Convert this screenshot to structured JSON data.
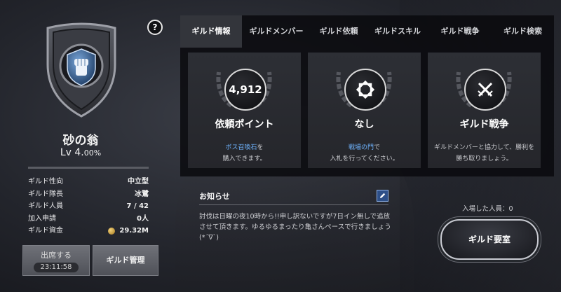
{
  "guild": {
    "name": "砂の翁",
    "level_label": "Lv 4.",
    "level_pct": "00%",
    "level_progress": 0.0
  },
  "help_icon_text": "?",
  "info": [
    {
      "label": "ギルド性向",
      "value": "中立型"
    },
    {
      "label": "ギルド隊長",
      "value": "冰鷺"
    },
    {
      "label": "ギルド人員",
      "value": "7 / 42"
    },
    {
      "label": "加入申請",
      "value": "0人"
    },
    {
      "label": "ギルド資金",
      "value": "29.32M"
    }
  ],
  "buttons": {
    "attendance_label": "出席する",
    "attendance_timer": "23:11:58",
    "manage_label": "ギルド管理",
    "room_label": "ギルド要室"
  },
  "tabs": [
    {
      "label": "ギルド情報"
    },
    {
      "label": "ギルドメンバー"
    },
    {
      "label": "ギルド依頼"
    },
    {
      "label": "ギルドスキル"
    },
    {
      "label": "ギルド戦争"
    },
    {
      "label": "ギルド検索"
    }
  ],
  "cards": [
    {
      "medal": "4,912",
      "title": "依頼ポイント",
      "link": "ボス召喚石",
      "desc1_rest": "を",
      "desc2": "購入できます。",
      "icon": "points-medal"
    },
    {
      "medal": "",
      "title": "なし",
      "link": "戦場の門",
      "desc1_rest": "で",
      "desc2": "入札を行ってください。",
      "icon": "battlefield-gate-icon"
    },
    {
      "medal": "",
      "title": "ギルド戦争",
      "link": "",
      "desc1_rest": "ギルドメンバーと協力して、勝利を",
      "desc2": "勝ち取りましょう。",
      "icon": "crossed-swords-icon"
    }
  ],
  "notice": {
    "title": "お知らせ",
    "body": "討伐は日曜の夜10時から!!申し訳ないですが7日イン無しで追放させて頂きます。ゆるゆるまったり亀さんペースで行きましょう(*´∇`)"
  },
  "entered_members": "入場した人員：0",
  "colors": {
    "accent_blue": "#6fb4ff",
    "panel_bg": "#08090c",
    "active_tab": "#33353b"
  }
}
